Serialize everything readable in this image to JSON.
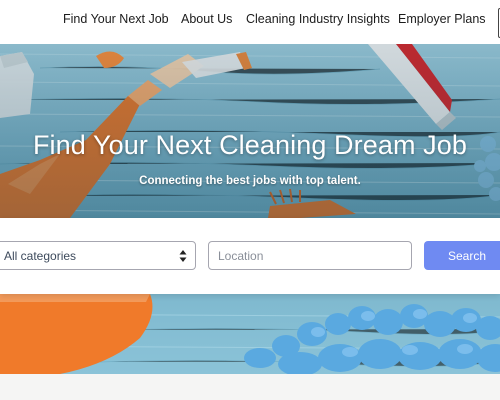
{
  "nav": {
    "items": [
      {
        "label": "Find Your Next Job"
      },
      {
        "label": "About Us"
      },
      {
        "label": "Cleaning Industry Insights"
      },
      {
        "label": "Employer Plans"
      }
    ]
  },
  "hero": {
    "title": "Find Your Next Cleaning Dream Job",
    "subtitle": "Connecting the best jobs with top talent."
  },
  "search": {
    "category_value": "All categories",
    "location_placeholder": "Location",
    "button_label": "Search"
  },
  "colors": {
    "accent": "#6f8af2",
    "hero_blue": "#83bdd3",
    "spray_bottle_orange": "#f07a2a",
    "microfiber_blue": "#5aa9e0"
  },
  "icons": [
    "select-arrows-icon",
    "menu-toggle-icon"
  ]
}
